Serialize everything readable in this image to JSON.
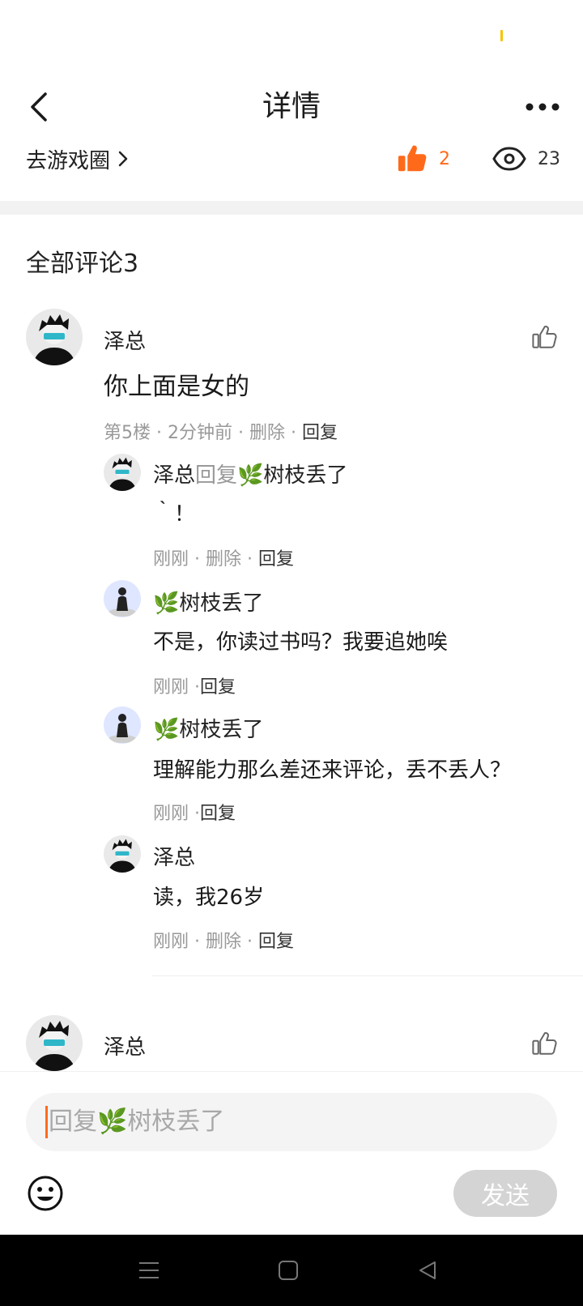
{
  "header": {
    "title": "详情"
  },
  "meta": {
    "game_link": "去游戏圈",
    "likes": "2",
    "views": "23"
  },
  "comments": {
    "title": "全部评论3",
    "first": {
      "author": "泽总",
      "text": "你上面是女的",
      "floor": "第5楼",
      "time": "2分钟前",
      "delete": "删除",
      "reply": "回复",
      "replies": [
        {
          "author": "泽总",
          "reply_word": "回复",
          "target": "🌿树枝丢了",
          "text": "｀！",
          "time": "刚刚",
          "delete": "删除",
          "reply": "回复"
        },
        {
          "author": "🌿树枝丢了",
          "text": "不是，你读过书吗？我要追她唉",
          "time": "刚刚",
          "reply": "回复"
        },
        {
          "author": "🌿树枝丢了",
          "text": "理解能力那么差还来评论，丢不丢人？",
          "time": "刚刚",
          "reply": "回复"
        },
        {
          "author": "泽总",
          "text": "读，我26岁",
          "time": "刚刚",
          "delete": "删除",
          "reply": "回复"
        }
      ]
    },
    "second": {
      "author": "泽总"
    }
  },
  "input": {
    "placeholder": "回复🌿树枝丢了",
    "send_label": "发送"
  },
  "colors": {
    "accent": "#ff6a1a",
    "send_disabled": "#d4d4d4",
    "status_dot": "#f5c400"
  },
  "icons": [
    "back-arrow-icon",
    "more-dots-icon",
    "chevron-right-icon",
    "thumb-up-filled-icon",
    "eye-icon",
    "thumb-up-outline-icon",
    "emoji-icon",
    "menu-icon",
    "home-square-icon",
    "back-triangle-icon"
  ]
}
